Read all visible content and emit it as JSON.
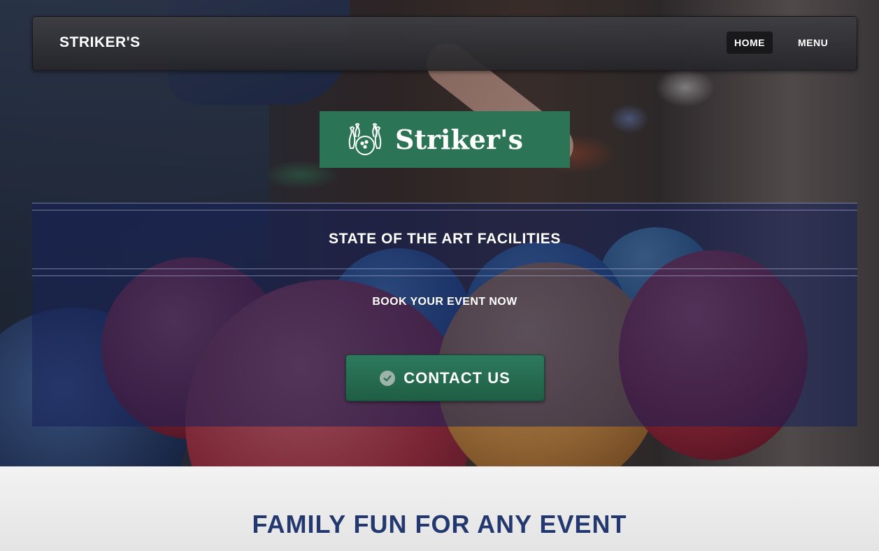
{
  "navbar": {
    "brand": "STRIKER'S",
    "links": [
      {
        "label": "HOME",
        "active": true
      },
      {
        "label": "MENU",
        "active": false
      }
    ]
  },
  "logo": {
    "text": "Striker's",
    "icon": "bowling-pins-icon",
    "background_color": "#2b7556"
  },
  "hero": {
    "headline": "STATE OF THE ART FACILITIES",
    "subline": "BOOK YOUR EVENT NOW",
    "cta": {
      "label": "CONTACT US",
      "icon": "check-circle-icon",
      "color": "#2d7a5e"
    }
  },
  "section": {
    "title": "FAMILY FUN FOR ANY EVENT",
    "title_color": "#23386e"
  }
}
